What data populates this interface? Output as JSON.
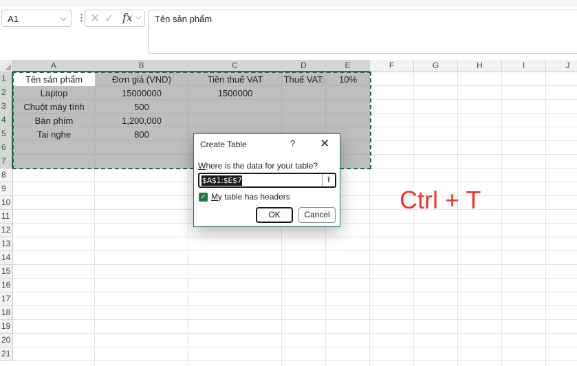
{
  "formula_bar": {
    "name_box": "A1",
    "fx_label": "fx",
    "content": "Tên sản phẩm"
  },
  "icons": {
    "cancel": "close-icon",
    "enter": "checkmark-icon",
    "expand": "chevron-down-icon",
    "collapse_dialog": "arrow-up-icon"
  },
  "columns": [
    "A",
    "B",
    "C",
    "D",
    "E",
    "F",
    "G",
    "H",
    "I",
    "J"
  ],
  "rows": [
    "1",
    "2",
    "3",
    "4",
    "5",
    "6",
    "7",
    "8",
    "9",
    "10",
    "11",
    "12",
    "13",
    "14",
    "15",
    "16",
    "17",
    "18",
    "19",
    "20",
    "21"
  ],
  "cells": {
    "A1": "Tên sản phẩm",
    "B1": "Đơn giá (VND)",
    "C1": "Tiền thuế VAT",
    "D1": "Thuế VAT:",
    "E1": "10%",
    "A2": "Laptop",
    "B2": "15000000",
    "C2": "1500000",
    "A3": "Chuột máy tính",
    "B3": "500",
    "A4": "Bàn phím",
    "B4": "1,200,000",
    "A5": "Tai nghe",
    "B5": "800"
  },
  "dialog": {
    "title": "Create Table",
    "help": "?",
    "close": "✕",
    "prompt_accel": "W",
    "prompt_rest": "here is the data for your table?",
    "range_value": "$A$1:$E$7",
    "checkbox_checked": true,
    "checkbox_accel": "M",
    "checkbox_rest": "y table has headers",
    "ok_label": "OK",
    "cancel_label": "Cancel"
  },
  "annotation": "Ctrl + T",
  "colors": {
    "accent": "#1f7a44",
    "annotation": "#e8392a"
  }
}
